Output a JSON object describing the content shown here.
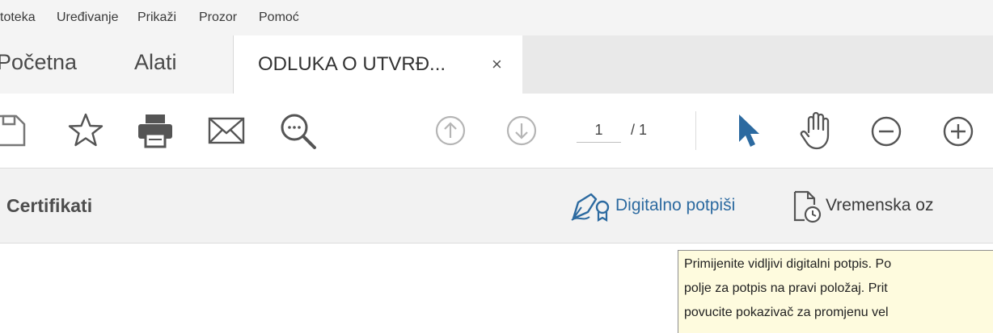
{
  "menu": {
    "items": [
      "toteka",
      "Uređivanje",
      "Prikaži",
      "Prozor",
      "Pomoć"
    ]
  },
  "tabs": {
    "home_label": "Početna",
    "tools_label": "Alati",
    "document_label": "ODLUKA O UTVRĐ...",
    "close_glyph": "×"
  },
  "toolbar": {
    "current_page": "1",
    "total_pages": "/ 1",
    "icons": [
      "save-icon",
      "star-icon",
      "print-icon",
      "mail-icon",
      "search-zoom-icon",
      "page-up-icon",
      "page-down-icon",
      "select-cursor-icon",
      "hand-icon",
      "zoom-out-icon",
      "zoom-in-icon"
    ],
    "accent_color": "#2c6aa0"
  },
  "certificates": {
    "title": "Certifikati",
    "sign_label": "Digitalno potpiši",
    "timestamp_label": "Vremenska oz"
  },
  "tooltip": {
    "lines": [
      "Primijenite vidljivi digitalni potpis. Po",
      "polje za potpis na pravi položaj. Prit",
      "povucite pokazivač za promjenu vel"
    ],
    "background": "#fefbde"
  }
}
